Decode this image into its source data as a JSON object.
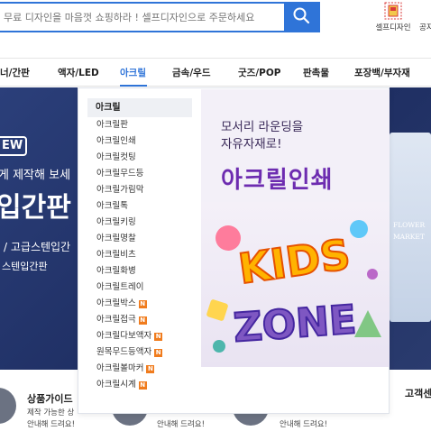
{
  "header": {
    "search_placeholder": "무료 디자인을 마음껏 쇼핑하라 ! 셀프디자인으로 주문하세요",
    "self_design_label": "셀프디자인",
    "notice_label": "공지"
  },
  "nav": {
    "items": [
      "너/간판",
      "액자/LED",
      "아크릴",
      "금속/우드",
      "굿즈/POP",
      "판촉물",
      "포장백/부자재"
    ],
    "active": "아크릴"
  },
  "hero": {
    "badge": "EW",
    "line1": "게 제작해 보세",
    "line2": "입간판",
    "line3": "/ 고급스텐입간",
    "line4": "스텐입간판",
    "flower_line1": "FLOWER",
    "flower_line2": "MARKET"
  },
  "dropdown": {
    "heading": "아크릴",
    "items": [
      {
        "label": "아크릴판",
        "new": false
      },
      {
        "label": "아크릴인쇄",
        "new": false
      },
      {
        "label": "아크릴컷팅",
        "new": false
      },
      {
        "label": "아크릴무드등",
        "new": false
      },
      {
        "label": "아크릴가림막",
        "new": false
      },
      {
        "label": "아크릴톡",
        "new": false
      },
      {
        "label": "아크릴키링",
        "new": false
      },
      {
        "label": "아크릴명찰",
        "new": false
      },
      {
        "label": "아크릴비츠",
        "new": false
      },
      {
        "label": "아크릴화병",
        "new": false
      },
      {
        "label": "아크릴트레이",
        "new": false
      },
      {
        "label": "아크릴박스",
        "new": true
      },
      {
        "label": "아크릴접극",
        "new": true
      },
      {
        "label": "아크릴다보액자",
        "new": true
      },
      {
        "label": "원목무드등액자",
        "new": true
      },
      {
        "label": "아크릴볼마커",
        "new": true
      },
      {
        "label": "아크릴시계",
        "new": true
      }
    ],
    "new_tag": "N",
    "promo_line1": "모서리 라운딩을",
    "promo_line2": "자유자재로!",
    "promo_big": "아크릴인쇄",
    "promo_art_text_1": "KIDS",
    "promo_art_text_2": "ZONE"
  },
  "bottom": {
    "guide_title": "상품가이드",
    "guide_sub1": "제작 가능한 상",
    "guide_sub2": "안내해 드려요!",
    "guide_sub3": "안내해 드려요!",
    "guide_sub4": "안내해 드려요!",
    "cs_title": "고객센"
  },
  "colors": {
    "accent": "#2f74d8",
    "new_tag": "#f07c1e",
    "promo_purple": "#6d2cb0"
  }
}
